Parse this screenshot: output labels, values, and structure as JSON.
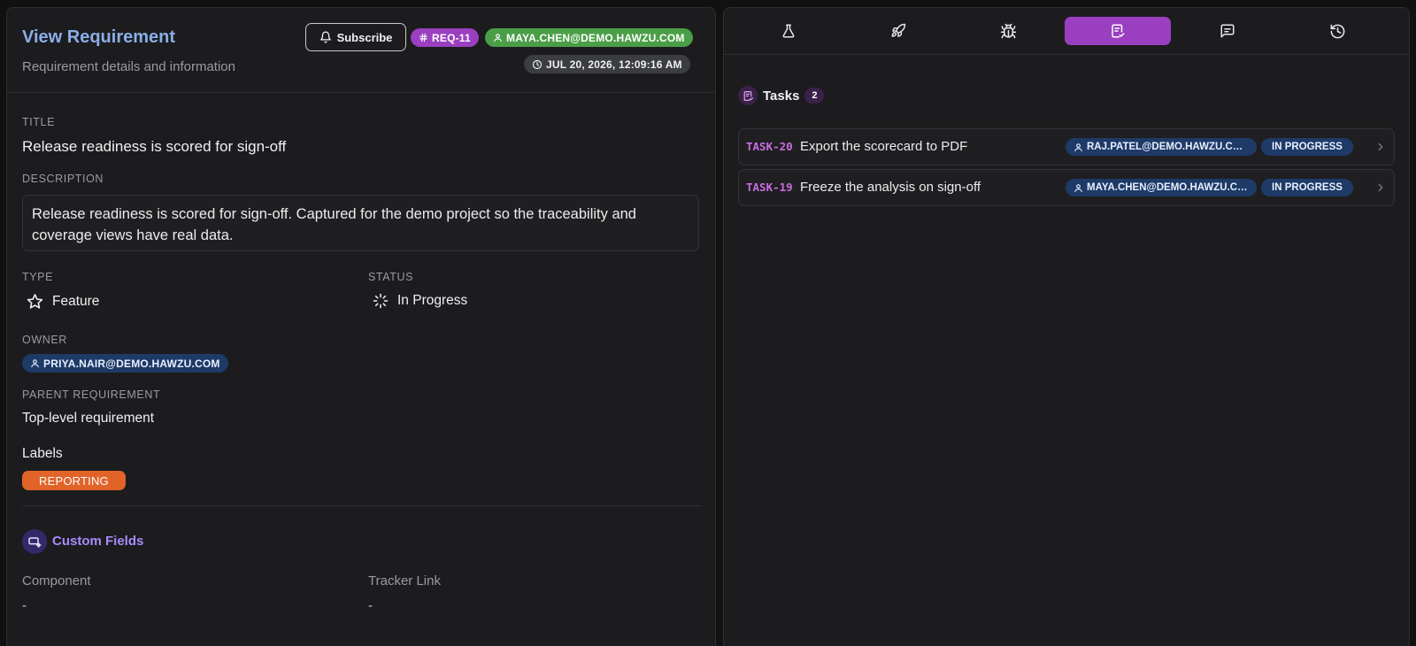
{
  "header": {
    "title": "View Requirement",
    "subtitle": "Requirement details and information",
    "subscribe_label": "Subscribe",
    "req_id": "REQ-11",
    "creator_email": "MAYA.CHEN@DEMO.HAWZU.COM",
    "created_at": "JUL 20, 2026, 12:09:16 AM"
  },
  "details": {
    "title_label": "TITLE",
    "title_value": "Release readiness is scored for sign-off",
    "description_label": "DESCRIPTION",
    "description_value": "Release readiness is scored for sign-off. Captured for the demo project so the traceability and coverage views have real data.",
    "type_label": "TYPE",
    "type_value": "Feature",
    "status_label": "STATUS",
    "status_value": "In Progress",
    "owner_label": "OWNER",
    "owner_value": "PRIYA.NAIR@DEMO.HAWZU.COM",
    "parent_label": "PARENT REQUIREMENT",
    "parent_value": "Top-level requirement",
    "labels_label": "Labels",
    "labels": [
      "REPORTING"
    ]
  },
  "custom_fields": {
    "title": "Custom Fields",
    "fields": [
      {
        "label": "Component",
        "value": "-"
      },
      {
        "label": "Tracker Link",
        "value": "-"
      }
    ]
  },
  "tabs": [
    {
      "icon": "flask-icon",
      "active": false
    },
    {
      "icon": "rocket-icon",
      "active": false
    },
    {
      "icon": "bug-icon",
      "active": false
    },
    {
      "icon": "task-list-icon",
      "active": true
    },
    {
      "icon": "comment-icon",
      "active": false
    },
    {
      "icon": "history-icon",
      "active": false
    }
  ],
  "tasks": {
    "title": "Tasks",
    "count": "2",
    "items": [
      {
        "id": "TASK-20",
        "name": "Export the scorecard to PDF",
        "assignee": "RAJ.PATEL@DEMO.HAWZU.COM",
        "status": "IN PROGRESS"
      },
      {
        "id": "TASK-19",
        "name": "Freeze the analysis on sign-off",
        "assignee": "MAYA.CHEN@DEMO.HAWZU.COM",
        "status": "IN PROGRESS"
      }
    ]
  },
  "colors": {
    "accent": "#9b3fc1",
    "title_blue": "#8aaee8",
    "badge_green": "#4b9e48",
    "badge_blue": "#1e3a66",
    "label_orange": "#e06328"
  }
}
